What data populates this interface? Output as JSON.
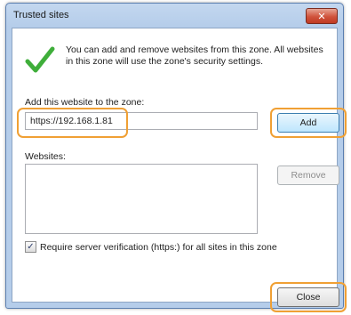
{
  "dialog": {
    "title": "Trusted sites",
    "close_glyph": "✕",
    "info_text": "You can add and remove websites from this zone. All websites in this zone will use the zone's security settings.",
    "add_label": "Add this website to the zone:",
    "url_value": "https://192.168.1.81",
    "add_button": "Add",
    "websites_label": "Websites:",
    "remove_button": "Remove",
    "verify_label": "Require server verification (https:) for all sites in this zone",
    "verify_checked": true,
    "close_button": "Close"
  },
  "icons": {
    "check": "checkmark-icon",
    "close": "close-icon"
  },
  "colors": {
    "highlight": "#f0a034",
    "check_green": "#3fae3a",
    "titlebar": "#c3d7ef"
  }
}
